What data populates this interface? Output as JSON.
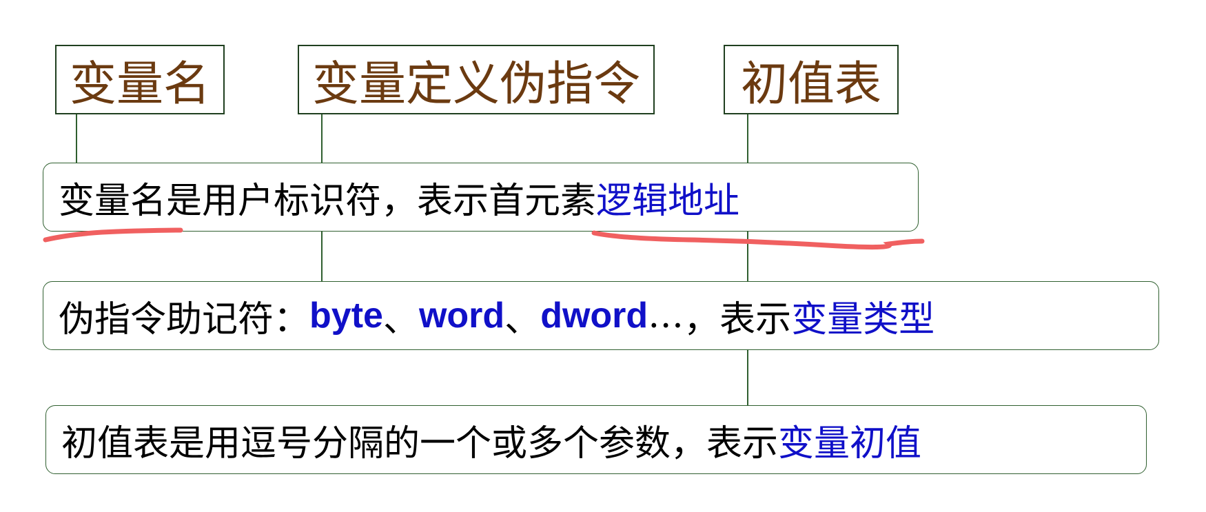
{
  "labels": {
    "var_name": "变量名",
    "var_directive": "变量定义伪指令",
    "init_table": "初值表"
  },
  "desc1": {
    "text": "变量名是用户标识符，表示首元素",
    "highlight": "逻辑地址"
  },
  "desc2": {
    "prefix": "伪指令助记符：",
    "kw1": "byte",
    "sep1": "、",
    "kw2": "word",
    "sep2": "、",
    "kw3": "dword",
    "ellipsis": "…",
    "middle": "，表示",
    "highlight": "变量类型"
  },
  "desc3": {
    "text": "初值表是用逗号分隔的一个或多个参数，表示",
    "highlight": "变量初值"
  },
  "colors": {
    "label_text": "#6b3a10",
    "highlight_text": "#1010c8",
    "box_border": "#2f5f2f",
    "annotation_stroke": "#f06060"
  }
}
